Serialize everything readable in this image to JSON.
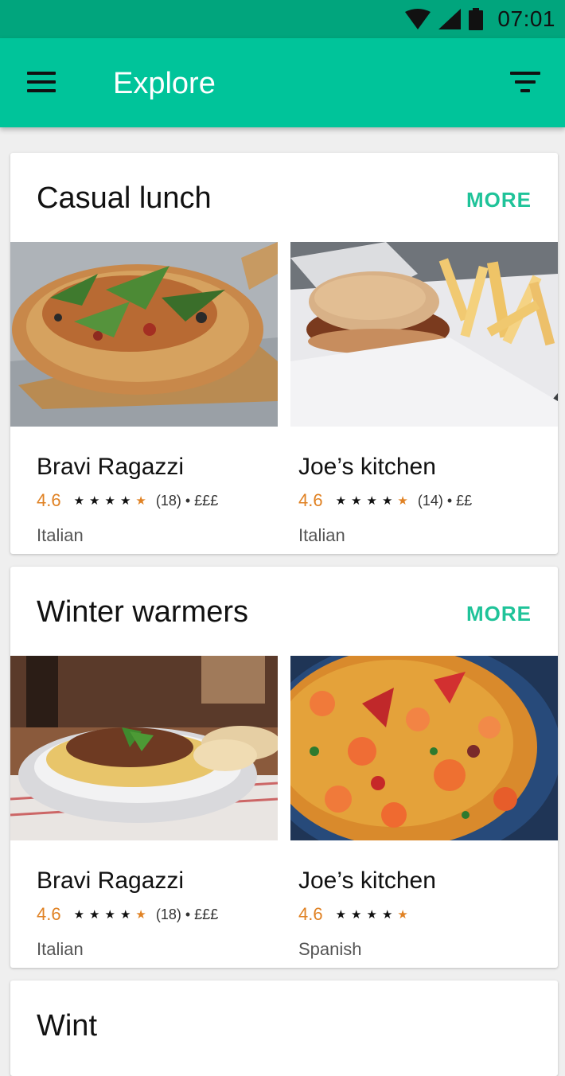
{
  "status_bar": {
    "time": "07:01"
  },
  "app_bar": {
    "title": "Explore"
  },
  "sections": [
    {
      "title": "Casual lunch",
      "more": "MORE",
      "items": [
        {
          "name": "Bravi Ragazzi",
          "rating": "4.6",
          "meta": "(18) • £££",
          "cuisine": "Italian"
        },
        {
          "name": "Joe’s kitchen",
          "rating": "4.6",
          "meta": "(14) • ££",
          "cuisine": "Italian"
        }
      ]
    },
    {
      "title": "Winter warmers",
      "more": "MORE",
      "items": [
        {
          "name": "Bravi Ragazzi",
          "rating": "4.6",
          "meta": "(18) • £££",
          "cuisine": "Italian"
        },
        {
          "name": "Joe’s kitchen",
          "rating": "4.6",
          "meta": "",
          "cuisine": "Spanish"
        }
      ]
    },
    {
      "title": "Wint"
    }
  ],
  "colors": {
    "accent": "#00c49a",
    "status_bar": "#01a57d",
    "rating": "#e08224",
    "more": "#1fc399"
  }
}
